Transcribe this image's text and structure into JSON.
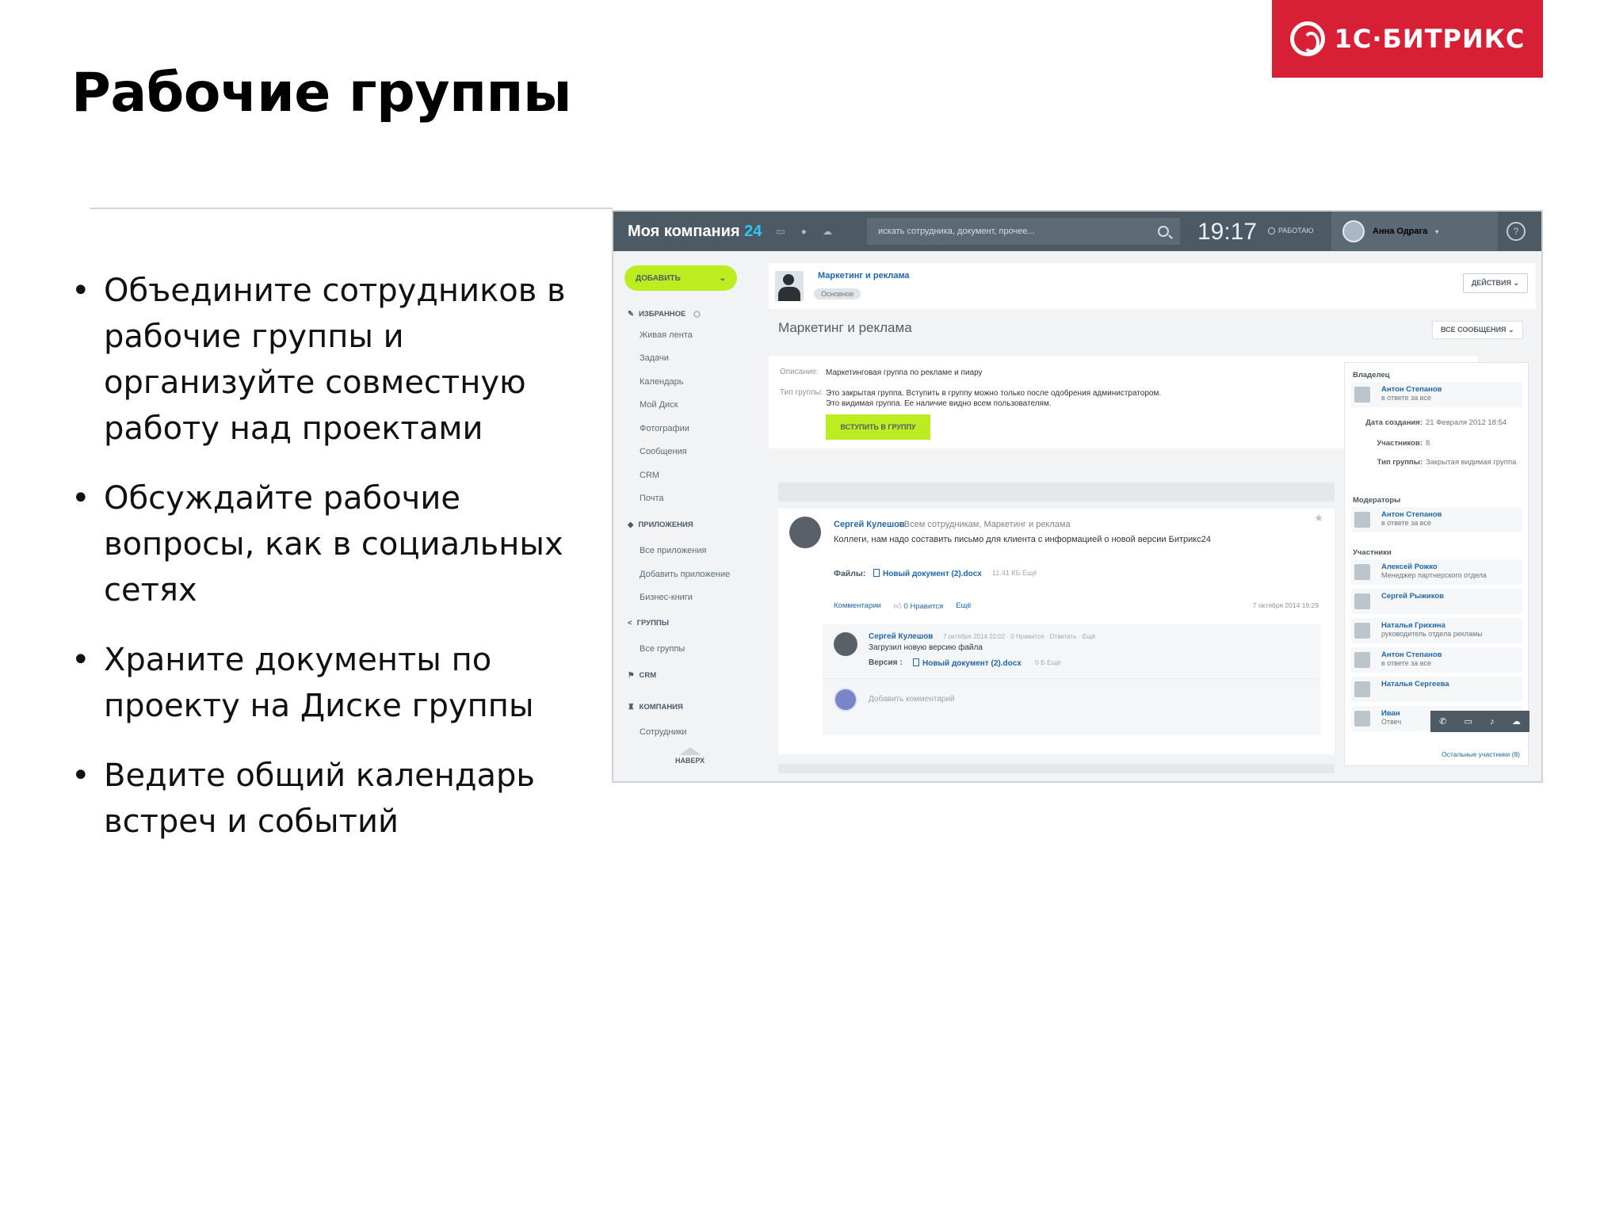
{
  "slide": {
    "title": "Рабочие группы",
    "logo_text": "1С·БИТРИКС",
    "bullets": [
      "Объедините сотрудников в рабочие группы и организуйте совместную работу над проектами",
      "Обсуждайте рабочие вопросы, как в социальных сетях",
      "Храните документы по проекту на Диске группы",
      "Ведите общий календарь встреч и событий"
    ]
  },
  "colors": {
    "brand_red": "#d71f35",
    "topbar": "#4c5a66",
    "accent_green": "#bbed21",
    "link_blue": "#2067b0",
    "accent_cyan": "#2fc6f6"
  },
  "app": {
    "header": {
      "company": "Моя компания",
      "company_suffix": "24",
      "search_placeholder": "искать сотрудника, документ, прочее...",
      "clock": "19:17",
      "work_status": "РАБОТАЮ",
      "user_name": "Анна Одрага",
      "help": "?"
    },
    "sidebar": {
      "add_button": "ДОБАВИТЬ",
      "sections": {
        "favorites": "ИЗБРАННОЕ",
        "apps": "ПРИЛОЖЕНИЯ",
        "groups": "ГРУППЫ",
        "crm": "CRM",
        "company": "КОМПАНИЯ"
      },
      "favorites_items": [
        "Живая лента",
        "Задачи",
        "Календарь",
        "Мой Диск",
        "Фотографии",
        "Сообщения",
        "CRM",
        "Почта"
      ],
      "apps_items": [
        "Все приложения",
        "Добавить приложение",
        "Бизнес-книги"
      ],
      "groups_items": [
        "Все группы"
      ],
      "company_items": [
        "Сотрудники"
      ],
      "up_label": "НАВЕРХ"
    },
    "group": {
      "name": "Маркетинг и реклама",
      "tag": "Основное",
      "actions_button": "ДЕЙСТВИЯ",
      "heading": "Маркетинг и реклама",
      "all_messages_button": "ВСЕ СООБЩЕНИЯ",
      "description_label": "Описание:",
      "description_value": "Маркетинговая группа по рекламе и пиару",
      "type_label": "Тип группы:",
      "type_value_1": "Это закрытая группа. Вступить в группу можно только после одобрения администратором.",
      "type_value_2": "Это видимая группа. Ее наличие видно всем пользователям.",
      "join_button": "ВСТУПИТЬ В ГРУППУ"
    },
    "panel": {
      "owner_title": "Владелец",
      "owner": {
        "name": "Антон Степанов",
        "role": "в ответе за все"
      },
      "created_key": "Дата создания:",
      "created_val": "21 Февраля 2012 18:54",
      "members_key": "Участников:",
      "members_val": "8",
      "type_key": "Тип группы:",
      "type_val": "Закрытая видимая группа",
      "moderators_title": "Модераторы",
      "moderator": {
        "name": "Антон Степанов",
        "role": "в ответе за все"
      },
      "participants_title": "Участники",
      "participants": [
        {
          "name": "Алексей Рожко",
          "role": "Менеджер партнерского отдела"
        },
        {
          "name": "Сергей Рыжиков",
          "role": ""
        },
        {
          "name": "Наталья Грихина",
          "role": "руководитель отдела рекламы"
        },
        {
          "name": "Антон Степанов",
          "role": "в ответе за все"
        },
        {
          "name": "Наталья Сергеева",
          "role": ""
        },
        {
          "name": "Иван",
          "role": "Отвеч"
        }
      ],
      "more_link": "Остальные участники (8)"
    },
    "post": {
      "author": "Сергей Кулешов",
      "destination": "Всем сотрудникам, Маркетинг и реклама",
      "text": "Коллеги, нам надо составить письмо для клиента с информацией о новой версии Битрикс24",
      "files_label": "Файлы:",
      "file_name": "Новый документ (2).docx",
      "file_meta": "11.41 КБ Ещё",
      "action_comments": "Комментарии",
      "action_like": "0 Нравится",
      "action_more": "Ещё",
      "date": "7 октября 2014 19:29",
      "comment": {
        "author": "Сергей Кулешов",
        "meta": "7 октября 2014 22:02 · 0 Нравится · Ответить · Ещё",
        "text": "Загрузил новую версию файла",
        "version_label": "Версия :",
        "file_name": "Новый документ (2).docx",
        "file_meta": "0 Б Ещё"
      },
      "add_comment": "Добавить комментарий"
    }
  }
}
